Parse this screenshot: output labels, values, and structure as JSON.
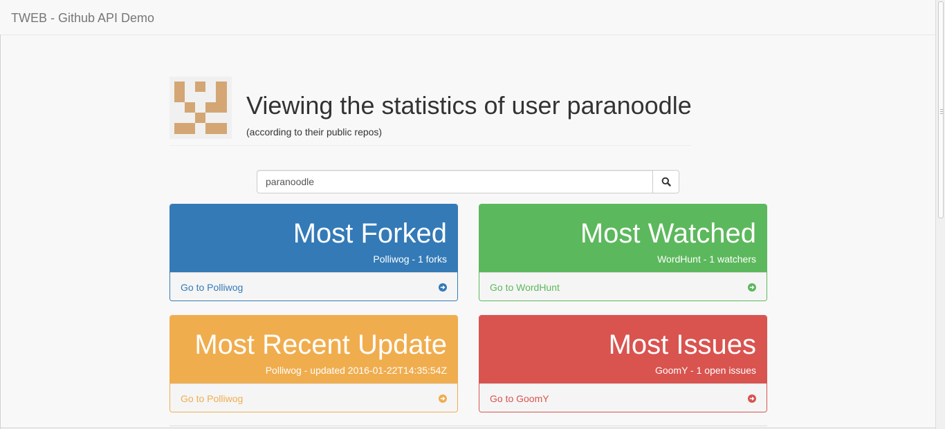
{
  "navbar": {
    "brand": "TWEB - Github API Demo"
  },
  "header": {
    "title": "Viewing the statistics of user paranoodle",
    "subtitle": "(according to their public repos)",
    "avatar_icon": "identicon-avatar"
  },
  "search": {
    "value": "paranoodle",
    "button_icon": "search-icon"
  },
  "panels": [
    {
      "heading": "Most Forked",
      "detail": "Polliwog - 1 forks",
      "link": "Go to Polliwog",
      "color": "#337ab7"
    },
    {
      "heading": "Most Watched",
      "detail": "WordHunt - 1 watchers",
      "link": "Go to WordHunt",
      "color": "#5cb85c"
    },
    {
      "heading": "Most Recent Update",
      "detail": "Polliwog - updated 2016-01-22T14:35:54Z",
      "link": "Go to Polliwog",
      "color": "#f0ad4e"
    },
    {
      "heading": "Most Issues",
      "detail": "GoomY - 1 open issues",
      "link": "Go to GoomY",
      "color": "#d9534f"
    }
  ]
}
